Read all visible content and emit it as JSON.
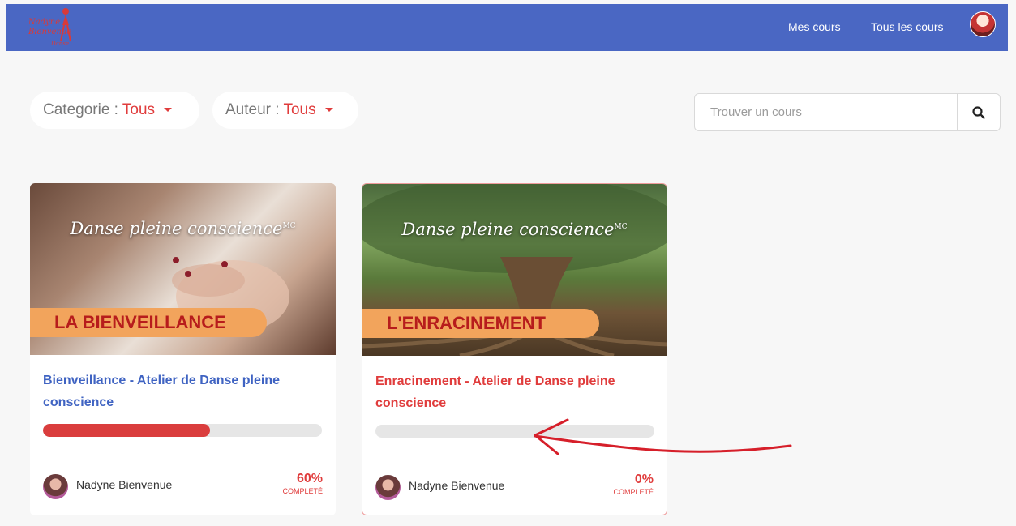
{
  "header": {
    "logo_text": [
      "Nadyne",
      "Bienvenue",
      "Danse"
    ],
    "nav": [
      {
        "label": "Mes cours"
      },
      {
        "label": "Tous les cours"
      }
    ]
  },
  "filters": {
    "category_label": "Categorie :",
    "category_value": "Tous",
    "author_label": "Auteur :",
    "author_value": "Tous"
  },
  "search": {
    "placeholder": "Trouver un cours"
  },
  "courses": [
    {
      "image_title": "Danse pleine conscience",
      "image_mark": "MC",
      "banner": "LA BIENVEILLANCE",
      "title": "Bienveillance - Atelier de Danse pleine conscience",
      "title_color": "#3f63c2",
      "progress": 60,
      "progress_label": "60%",
      "completed_label": "COMPLETÉ",
      "author": "Nadyne Bienvenue"
    },
    {
      "image_title": "Danse pleine conscience",
      "image_mark": "MC",
      "banner": "L'ENRACINEMENT",
      "title": "Enracinement - Atelier de Danse pleine conscience",
      "title_color": "#e03c3c",
      "progress": 0,
      "progress_label": "0%",
      "completed_label": "COMPLETÉ",
      "author": "Nadyne Bienvenue"
    }
  ],
  "colors": {
    "header_bg": "#4a67c3",
    "accent": "#e03c3c",
    "progress_track": "#e6e6e6"
  }
}
